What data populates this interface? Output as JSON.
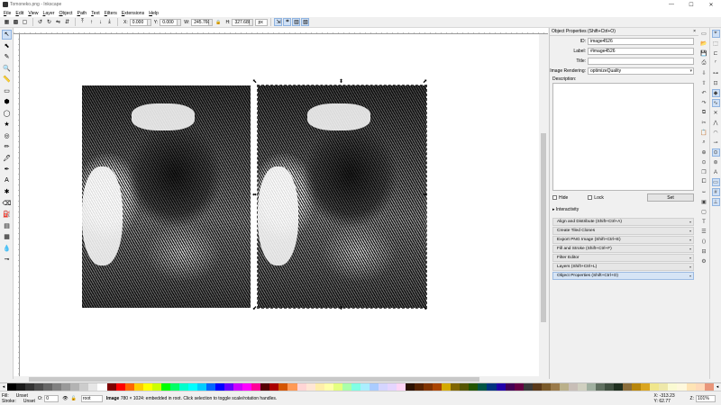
{
  "window": {
    "title": "Tomoneko.png - Inkscape",
    "controls": [
      "—",
      "☐",
      "✕"
    ]
  },
  "menu": [
    "File",
    "Edit",
    "View",
    "Layer",
    "Object",
    "Path",
    "Text",
    "Filters",
    "Extensions",
    "Help"
  ],
  "toolctrl": {
    "x_label": "X:",
    "x": "0.000",
    "y_label": "Y:",
    "y": "0.000",
    "w_label": "W:",
    "w": "245.760",
    "lock": "🔒",
    "h_label": "H:",
    "h": "327.680",
    "unit": "px"
  },
  "tools": [
    "selector",
    "node",
    "tweak",
    "zoom",
    "measure",
    "rect",
    "box3d",
    "ellipse",
    "star",
    "spiral",
    "pencil",
    "pen",
    "calligraphy",
    "text",
    "spray",
    "eraser",
    "bucket",
    "gradient",
    "mesh",
    "dropper",
    "connector"
  ],
  "tool_glyphs": [
    "↖",
    "⬉",
    "✎",
    "🔍",
    "📏",
    "▭",
    "⬢",
    "◯",
    "★",
    "◎",
    "✏",
    "🖋",
    "✒",
    "A",
    "✱",
    "⌫",
    "⛽",
    "▤",
    "▦",
    "💧",
    "⊸"
  ],
  "panel": {
    "title": "Object Properties (Shift+Ctrl+O)",
    "close": "×",
    "id_label": "ID:",
    "id": "image4526",
    "label_label": "Label:",
    "label": "#image4526",
    "title_label": "Title:",
    "title_value": "",
    "rendering_label": "Image Rendering:",
    "rendering": "optimizeQuality",
    "description_label": "Description:",
    "hide_label": "Hide",
    "lock_label": "Lock",
    "set_label": "Set",
    "interactivity_label": "Interactivity"
  },
  "dock": [
    "Align and Distribute (Shift+Ctrl+A)",
    "Create Tiled Clones",
    "Export PNG Image (Shift+Ctrl+E)",
    "Fill and Stroke (Shift+Ctrl+F)",
    "Filter Editor",
    "Layers (Shift+Ctrl+L)",
    "Object Properties (Shift+Ctrl+O)"
  ],
  "palette_colors": [
    "#000000",
    "#1a1a1a",
    "#333333",
    "#4d4d4d",
    "#666666",
    "#808080",
    "#999999",
    "#b3b3b3",
    "#cccccc",
    "#e6e6e6",
    "#ffffff",
    "#800000",
    "#ff0000",
    "#ff6600",
    "#ffcc00",
    "#ffff00",
    "#ccff00",
    "#00ff00",
    "#00ff66",
    "#00ffcc",
    "#00ffff",
    "#00ccff",
    "#0066ff",
    "#0000ff",
    "#6600ff",
    "#cc00ff",
    "#ff00ff",
    "#ff0099",
    "#550000",
    "#aa0000",
    "#d45500",
    "#ff9955",
    "#ffd5d5",
    "#ffe6d5",
    "#ffeeaa",
    "#ffffaa",
    "#e5ff80",
    "#aaffaa",
    "#80ffe5",
    "#aaeeff",
    "#aaccff",
    "#d5d5ff",
    "#e5d5ff",
    "#ffd5f6",
    "#2b1100",
    "#552200",
    "#803300",
    "#aa4400",
    "#d4aa00",
    "#806600",
    "#555500",
    "#225500",
    "#005544",
    "#003380",
    "#2200aa",
    "#440055",
    "#660044",
    "#3a3a3a",
    "#5a3a1a",
    "#7a5a2a",
    "#9a7a4a",
    "#bab08a",
    "#c8beb7",
    "#d0d0c0",
    "#a0b0a0",
    "#607060",
    "#405040",
    "#203020",
    "#8a6d3b",
    "#b8860b",
    "#daa520",
    "#f0e68c",
    "#eee8aa",
    "#fafad2",
    "#fff8dc",
    "#ffe4b5",
    "#ffdab9",
    "#e9967a"
  ],
  "status": {
    "fill_label": "Fill:",
    "fill": "Unset",
    "stroke_label": "Stroke:",
    "stroke": "Unset",
    "opacity_label": "O:",
    "opacity": "0",
    "layer": "root",
    "message_bold": "Image",
    "message": " 780 × 1024: embedded in root. Click selection to toggle scale/rotation handles.",
    "x_label": "X:",
    "x": "-313.23",
    "y_label": "Y:",
    "y": "62.77",
    "zoom_label": "Z:",
    "zoom": "101%"
  }
}
